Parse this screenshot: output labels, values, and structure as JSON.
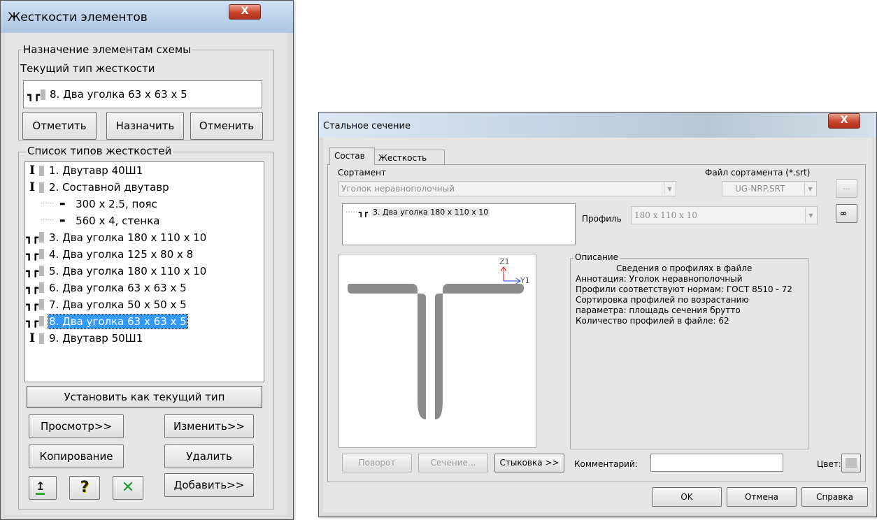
{
  "left_dialog": {
    "title": "Жесткости элементов",
    "close_glyph": "X",
    "assign_group": {
      "legend": "Назначение элементам схемы",
      "current_label": "Текущий тип жесткости",
      "current_value": "8. Два уголка 63 x 63 x 5",
      "current_icon": "double-angle-icon",
      "buttons": [
        "Отметить",
        "Назначить",
        "Отменить"
      ]
    },
    "list_group": {
      "legend": "Список типов жесткостей",
      "items": [
        {
          "icon": "i-beam-icon",
          "label": "1. Двутавр 40Ш1",
          "selected": false
        },
        {
          "icon": "i-beam-icon",
          "label": "2. Составной двутавр",
          "selected": false
        },
        {
          "icon": "dash-icon",
          "label": "300 x 2.5, пояс",
          "selected": false
        },
        {
          "icon": "dash-icon",
          "label": "560 x 4, стенка",
          "selected": false
        },
        {
          "icon": "double-angle-icon",
          "label": "3. Два уголка 180 x 110 x 10",
          "selected": false
        },
        {
          "icon": "double-angle-icon",
          "label": "4. Два уголка 125 x 80 x 8",
          "selected": false
        },
        {
          "icon": "double-angle-icon",
          "label": "5. Два уголка 180 x 110 x 10",
          "selected": false
        },
        {
          "icon": "double-angle-icon",
          "label": "6. Два уголка 63 x 63 x 5",
          "selected": false
        },
        {
          "icon": "double-angle-icon",
          "label": "7. Два уголка 50 x 50 x 5",
          "selected": false
        },
        {
          "icon": "double-angle-icon",
          "label": "8. Два уголка 63 x 63 x 5",
          "selected": true
        },
        {
          "icon": "i-beam-icon",
          "label": "9. Двутавр 50Ш1",
          "selected": false
        }
      ]
    },
    "set_current_button": "Установить как текущий тип",
    "view_button": "Просмотр>>",
    "edit_button": "Изменить>>",
    "copy_button": "Копирование",
    "delete_button": "Удалить",
    "add_button": "Добавить>>",
    "help_glyph": "?",
    "close_x_glyph": "✕"
  },
  "right_dialog": {
    "title": "Стальное сечение",
    "close_glyph": "X",
    "tabs": [
      "Состав",
      "Жесткость"
    ],
    "assortment_label": "Сортамент",
    "assortment_value": "Уголок  неравнополочный",
    "file_label": "Файл сортамента (*.srt)",
    "file_value": "UG-NRP.SRT",
    "browse_glyph": "...",
    "tree_item": "3. Два уголка 180 x 110 x 10",
    "profile_label": "Профиль",
    "profile_value": "180 x 110 x 10",
    "axis_z": "Z1",
    "axis_y": "Y1",
    "description": {
      "legend": "Описание",
      "lines": [
        "Сведения о профилях в файле",
        "Аннотация: Уголок  неравнополочный",
        "Профили соответствуют нормам: ГОСТ 8510 - 72",
        "Сортировка профилей по возрастанию",
        "параметра: площадь сечения брутто",
        "Количество профилей в файле: 62"
      ]
    },
    "rotate_button": "Поворот",
    "section_button": "Сечение...",
    "joint_button": "Стыковка >>",
    "comment_label": "Комментарий:",
    "comment_value": "",
    "color_label": "Цвет:",
    "ok_button": "OK",
    "cancel_button": "Отмена",
    "help_button": "Справка"
  }
}
